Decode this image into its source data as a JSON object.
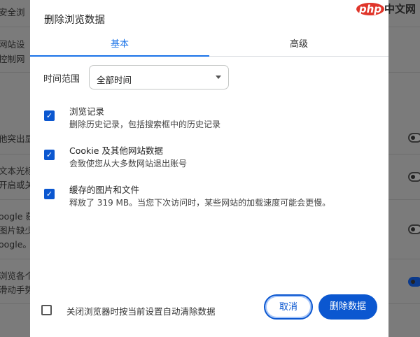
{
  "background": {
    "texts": [
      "安全浏",
      "网站设",
      "控制网",
      "他突出显",
      "文本光标",
      "开启或关",
      "oogle 获",
      "图片缺少",
      "oogle。",
      "浏览各个",
      "滑动手势"
    ]
  },
  "watermark": "php中文网",
  "dialog": {
    "title": "删除浏览数据",
    "tabs": [
      {
        "label": "基本",
        "active": true
      },
      {
        "label": "高级",
        "active": false
      }
    ],
    "time_range": {
      "label": "时间范围",
      "value": "全部时间"
    },
    "options": [
      {
        "title": "浏览记录",
        "subtitle": "删除历史记录，包括搜索框中的历史记录",
        "checked": true
      },
      {
        "title": "Cookie 及其他网站数据",
        "subtitle": "会致使您从大多数网站退出账号",
        "checked": true
      },
      {
        "title": "缓存的图片和文件",
        "subtitle": "释放了 319 MB。当您下次访问时，某些网站的加载速度可能会更慢。",
        "checked": true
      }
    ],
    "auto_clear": {
      "label": "关闭浏览器时按当前设置自动清除数据",
      "checked": false
    },
    "cancel_label": "取消",
    "delete_label": "删除数据"
  },
  "colors": {
    "accent": "#0b57d0",
    "tab_active": "#1a73e8"
  }
}
